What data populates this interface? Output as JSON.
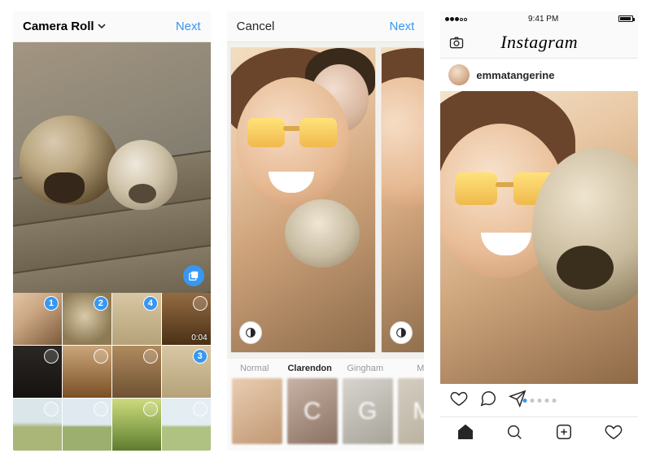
{
  "screen1": {
    "album_selector": "Camera Roll",
    "next": "Next",
    "grid": [
      {
        "kind": "people",
        "selected_order": 1
      },
      {
        "kind": "dog-closeup",
        "selected_order": 2
      },
      {
        "kind": "dog-light",
        "selected_order": 4
      },
      {
        "kind": "dog-brown",
        "video_duration": "0:04"
      },
      {
        "kind": "dog-dark",
        "unselected": true
      },
      {
        "kind": "dog-brown2",
        "unselected": true
      },
      {
        "kind": "dogs-two",
        "unselected": true
      },
      {
        "kind": "dog-tan",
        "selected_order": 3
      },
      {
        "kind": "landscape-1",
        "unselected": true
      },
      {
        "kind": "landscape-2",
        "unselected": true
      },
      {
        "kind": "field",
        "unselected": true
      },
      {
        "kind": "landscape-3",
        "unselected": true
      }
    ]
  },
  "screen2": {
    "cancel": "Cancel",
    "next": "Next",
    "filters": [
      {
        "name": "Normal",
        "letter": ""
      },
      {
        "name": "Clarendon",
        "letter": "C",
        "active": true
      },
      {
        "name": "Gingham",
        "letter": "G"
      },
      {
        "name": "M",
        "letter": "M",
        "truncated": true
      }
    ]
  },
  "screen3": {
    "status_time": "9:41 PM",
    "app_title": "Instagram",
    "username": "emmatangerine",
    "carousel_count": 5,
    "carousel_index": 1
  }
}
